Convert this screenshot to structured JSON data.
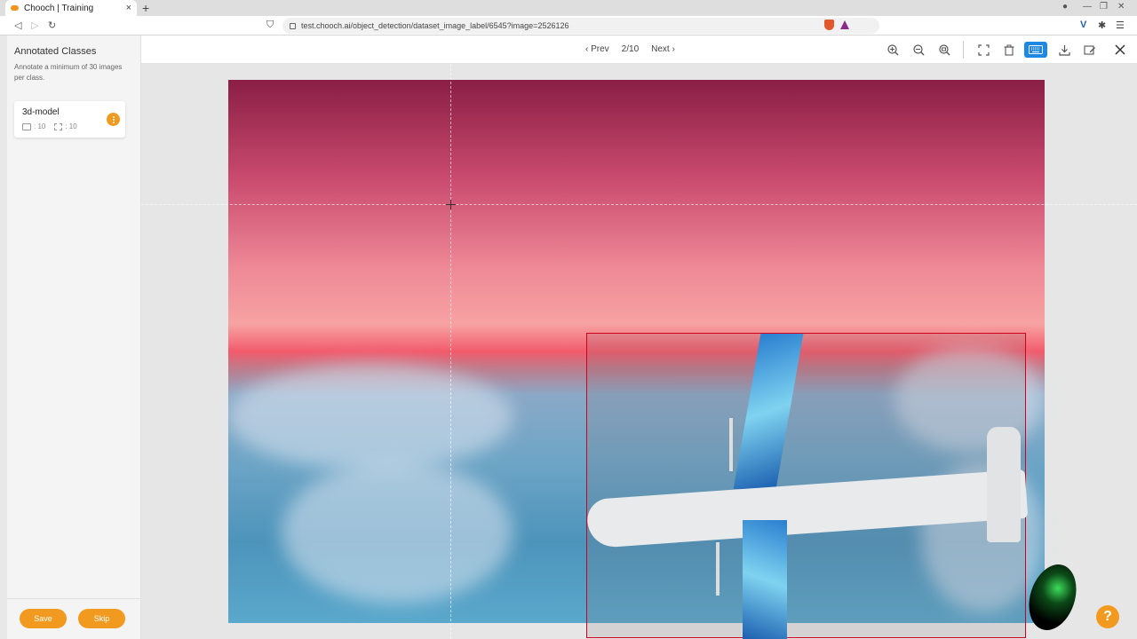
{
  "browser": {
    "tab_title": "Chooch | Training",
    "tab_close": "×",
    "new_tab": "+",
    "url": "test.chooch.ai/object_detection/dataset_image_label/6545?image=2526126"
  },
  "sidebar": {
    "title": "Annotated Classes",
    "hint": "Annotate a minimum of 30 images per class.",
    "classes": [
      {
        "name": "3d-model",
        "images": ": 10",
        "boxes": ": 10"
      }
    ],
    "save_label": "Save",
    "skip_label": "Skip"
  },
  "toolbar": {
    "prev_label": "Prev",
    "page": "2/10",
    "next_label": "Next"
  },
  "help_label": "?",
  "colors": {
    "accent": "#f29a1f",
    "active_tool": "#1e88e5",
    "bbox": "#d0021b"
  }
}
